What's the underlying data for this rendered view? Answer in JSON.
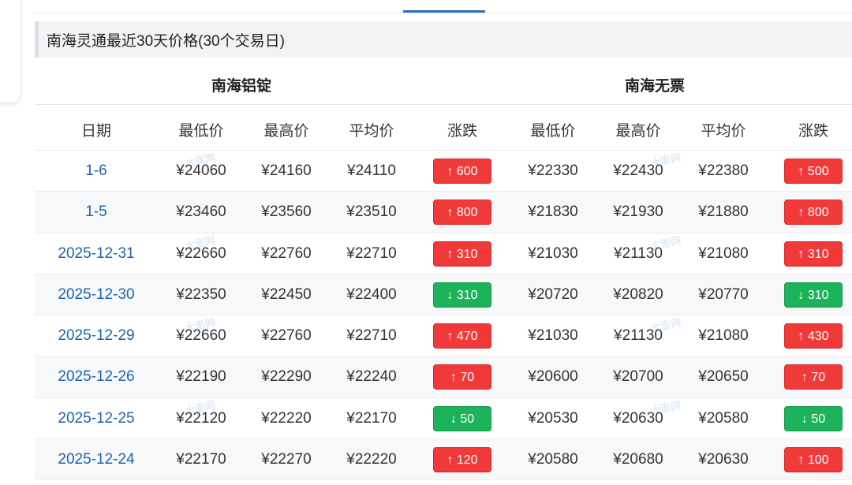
{
  "section_title": "南海灵通最近30天价格(30个交易日)",
  "groups": [
    "南海铝锭",
    "南海无票"
  ],
  "columns": [
    "日期",
    "最低价",
    "最高价",
    "平均价",
    "涨跌",
    "最低价",
    "最高价",
    "平均价",
    "涨跌"
  ],
  "watermark": "大澎网",
  "rows": [
    {
      "date": "1-6",
      "a_low": "¥24060",
      "a_high": "¥24160",
      "a_avg": "¥24110",
      "a_chg": "↑ 600",
      "a_dir": "up",
      "b_low": "¥22330",
      "b_high": "¥22430",
      "b_avg": "¥22380",
      "b_chg": "↑ 500",
      "b_dir": "up"
    },
    {
      "date": "1-5",
      "a_low": "¥23460",
      "a_high": "¥23560",
      "a_avg": "¥23510",
      "a_chg": "↑ 800",
      "a_dir": "up",
      "b_low": "¥21830",
      "b_high": "¥21930",
      "b_avg": "¥21880",
      "b_chg": "↑ 800",
      "b_dir": "up"
    },
    {
      "date": "2025-12-31",
      "a_low": "¥22660",
      "a_high": "¥22760",
      "a_avg": "¥22710",
      "a_chg": "↑ 310",
      "a_dir": "up",
      "b_low": "¥21030",
      "b_high": "¥21130",
      "b_avg": "¥21080",
      "b_chg": "↑ 310",
      "b_dir": "up"
    },
    {
      "date": "2025-12-30",
      "a_low": "¥22350",
      "a_high": "¥22450",
      "a_avg": "¥22400",
      "a_chg": "↓ 310",
      "a_dir": "down",
      "b_low": "¥20720",
      "b_high": "¥20820",
      "b_avg": "¥20770",
      "b_chg": "↓ 310",
      "b_dir": "down"
    },
    {
      "date": "2025-12-29",
      "a_low": "¥22660",
      "a_high": "¥22760",
      "a_avg": "¥22710",
      "a_chg": "↑ 470",
      "a_dir": "up",
      "b_low": "¥21030",
      "b_high": "¥21130",
      "b_avg": "¥21080",
      "b_chg": "↑ 430",
      "b_dir": "up"
    },
    {
      "date": "2025-12-26",
      "a_low": "¥22190",
      "a_high": "¥22290",
      "a_avg": "¥22240",
      "a_chg": "↑ 70",
      "a_dir": "up",
      "b_low": "¥20600",
      "b_high": "¥20700",
      "b_avg": "¥20650",
      "b_chg": "↑ 70",
      "b_dir": "up"
    },
    {
      "date": "2025-12-25",
      "a_low": "¥22120",
      "a_high": "¥22220",
      "a_avg": "¥22170",
      "a_chg": "↓ 50",
      "a_dir": "down",
      "b_low": "¥20530",
      "b_high": "¥20630",
      "b_avg": "¥20580",
      "b_chg": "↓ 50",
      "b_dir": "down"
    },
    {
      "date": "2025-12-24",
      "a_low": "¥22170",
      "a_high": "¥22270",
      "a_avg": "¥22220",
      "a_chg": "↑ 120",
      "a_dir": "up",
      "b_low": "¥20580",
      "b_high": "¥20680",
      "b_avg": "¥20630",
      "b_chg": "↑ 100",
      "b_dir": "up"
    }
  ]
}
